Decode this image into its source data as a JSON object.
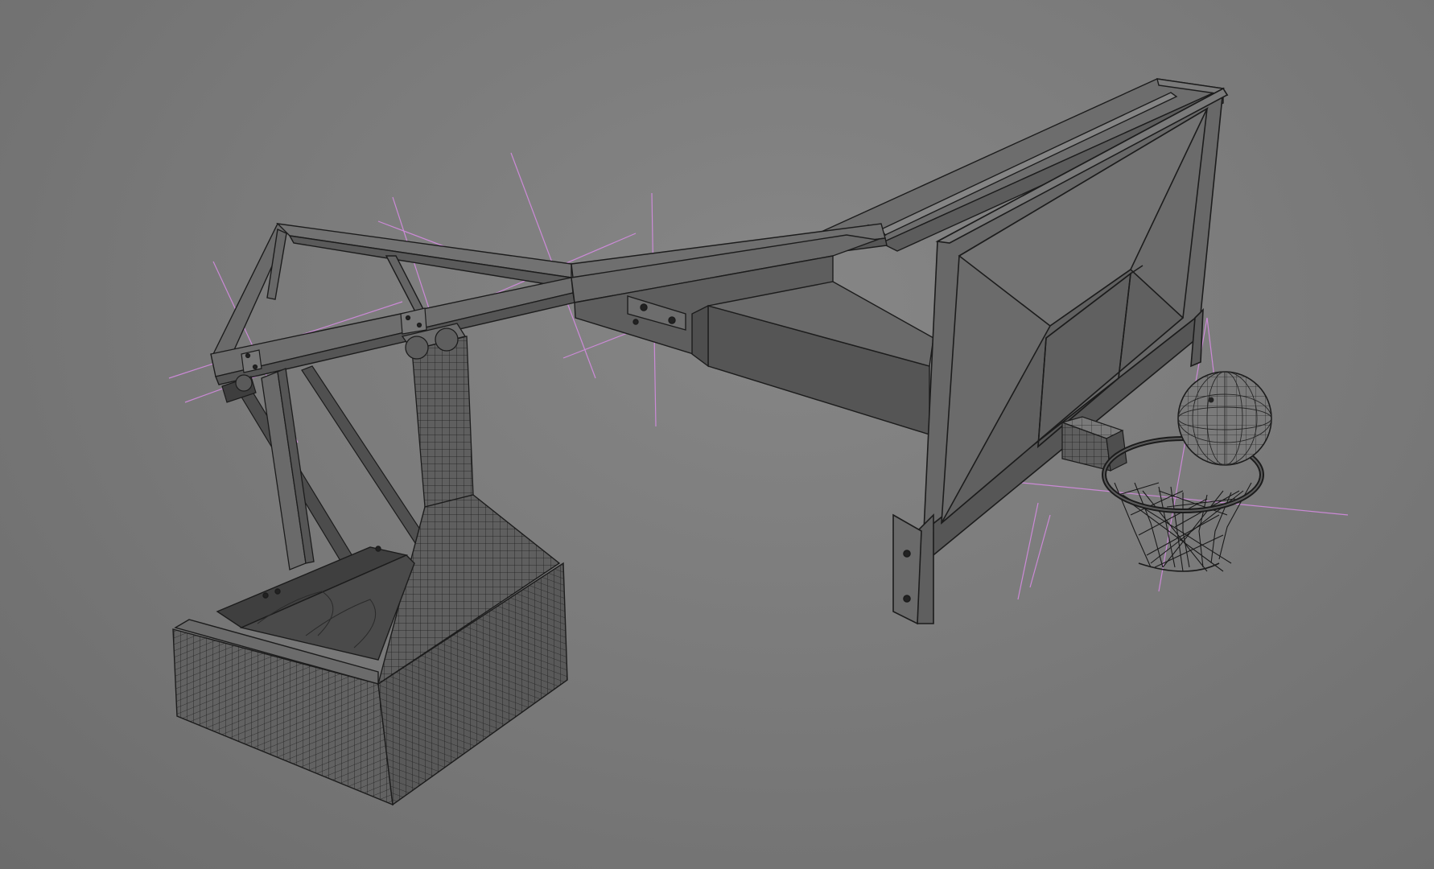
{
  "viewport": {
    "background": "#7b7b7b",
    "render_mode": "wireframe-on-shaded",
    "wire_color": "#1c1c1c",
    "shade_color": "#686868",
    "guide_color": "#d98ce6"
  },
  "scene": {
    "objects": [
      "base-counterweight",
      "base-column",
      "support-strut-front",
      "support-strut-rear",
      "boom-truss",
      "boom-arm",
      "boom-joint-bracket",
      "backboard-frame",
      "backboard-panel",
      "backboard-target-square",
      "rim-mount",
      "rim",
      "net",
      "basketball",
      "ik-guide-lines"
    ]
  }
}
